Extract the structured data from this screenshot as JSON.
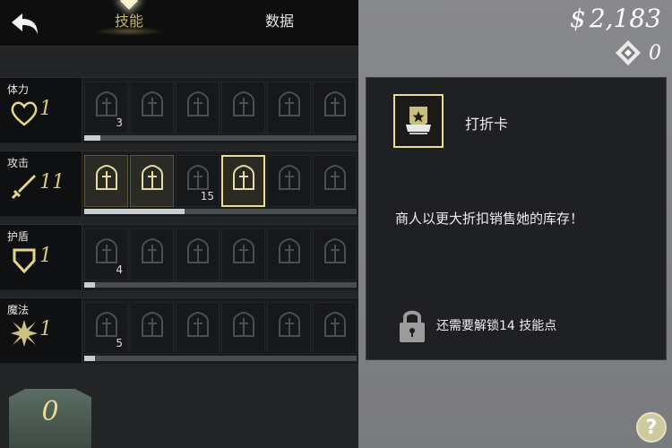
{
  "tabs": {
    "skills": "技能",
    "data": "数据"
  },
  "rows": [
    {
      "name": "体力",
      "icon": "heart-icon",
      "level": "1",
      "progress": 0.06,
      "cells": [
        {
          "icon": "heart-up-icon",
          "num": "3"
        },
        {
          "icon": "shields-up-icon",
          "num": ""
        },
        {
          "icon": "plus-gem-icon",
          "num": ""
        },
        {
          "icon": "percent-anvil-icon",
          "num": ""
        },
        {
          "icon": "crossed-swords-icon",
          "num": ""
        },
        {
          "icon": "plus-gem-icon",
          "num": ""
        }
      ]
    },
    {
      "name": "攻击",
      "icon": "sword-icon",
      "level": "11",
      "progress": 0.37,
      "cells": [
        {
          "icon": "sword-arrows-icon",
          "num": ""
        },
        {
          "icon": "shield-sword-arrows-icon",
          "num": ""
        },
        {
          "icon": "shield-sword-icon",
          "num": "15"
        },
        {
          "icon": "discount-card-icon",
          "num": ""
        },
        {
          "icon": "plus-anvil-icon",
          "num": ""
        },
        {
          "icon": "shields-up-icon",
          "num": ""
        }
      ]
    },
    {
      "name": "护盾",
      "icon": "shield-icon",
      "level": "1",
      "progress": 0.04,
      "cells": [
        {
          "icon": "sword-icon",
          "num": "4"
        },
        {
          "icon": "sword-chevrons-icon",
          "num": ""
        },
        {
          "icon": "chest-sword-icon",
          "num": ""
        },
        {
          "icon": "shield-bar-icon",
          "num": ""
        },
        {
          "icon": "potion-icon",
          "num": ""
        },
        {
          "icon": "potion-icon",
          "num": ""
        }
      ]
    },
    {
      "name": "魔法",
      "icon": "star-burst-icon",
      "level": "1",
      "progress": 0.04,
      "cells": [
        {
          "icon": "plus-potion-icon",
          "num": "5"
        },
        {
          "icon": "burst-chevrons-icon",
          "num": ""
        },
        {
          "icon": "plus-potion-icon",
          "num": ""
        },
        {
          "icon": "burst-chevrons-icon",
          "num": ""
        },
        {
          "icon": "flask-swords-icon",
          "num": ""
        },
        {
          "icon": "burst-chevrons-icon",
          "num": ""
        }
      ]
    }
  ],
  "skill_points": "0",
  "currency": {
    "symbol": "$",
    "value": "2,183"
  },
  "gems": {
    "value": "0"
  },
  "detail": {
    "title": "打折卡",
    "description": "商人以更大折扣销售她的库存！",
    "lock_text": "还需要解锁14 技能点"
  },
  "help_label": "?"
}
